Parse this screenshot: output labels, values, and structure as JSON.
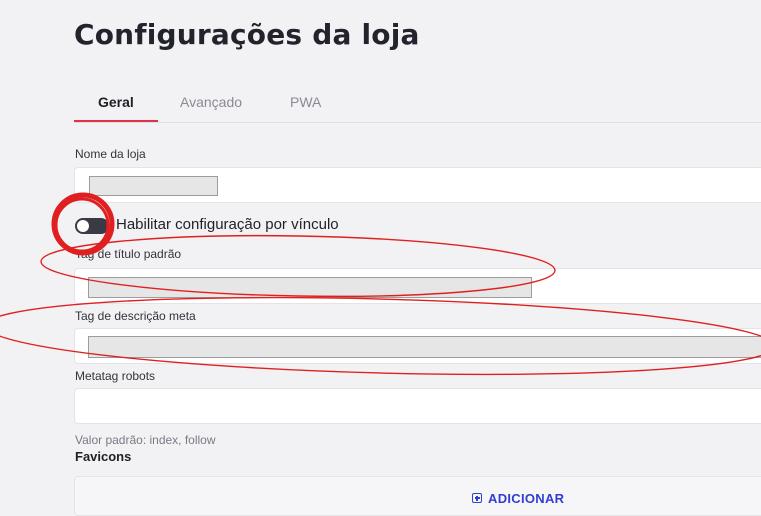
{
  "page": {
    "title": "Configurações da loja"
  },
  "tabs": [
    {
      "label": "Geral",
      "active": true
    },
    {
      "label": "Avançado",
      "active": false
    },
    {
      "label": "PWA",
      "active": false
    }
  ],
  "form": {
    "store_name_label": "Nome da loja",
    "link_toggle_label": "Habilitar configuração por vínculo",
    "link_toggle_on": false,
    "title_tag_label": "Tag de título padrão",
    "meta_description_label": "Tag de descrição meta",
    "robots_label": "Metatag robots",
    "robots_value": "",
    "robots_hint": "Valor padrão: index, follow"
  },
  "favicons": {
    "section_title": "Favicons",
    "add_label": "ADICIONAR"
  },
  "colors": {
    "accent": "#e0304a",
    "link": "#2f3fd0",
    "annotation": "#e02020"
  },
  "icons": {
    "add": "plus-square-icon"
  }
}
